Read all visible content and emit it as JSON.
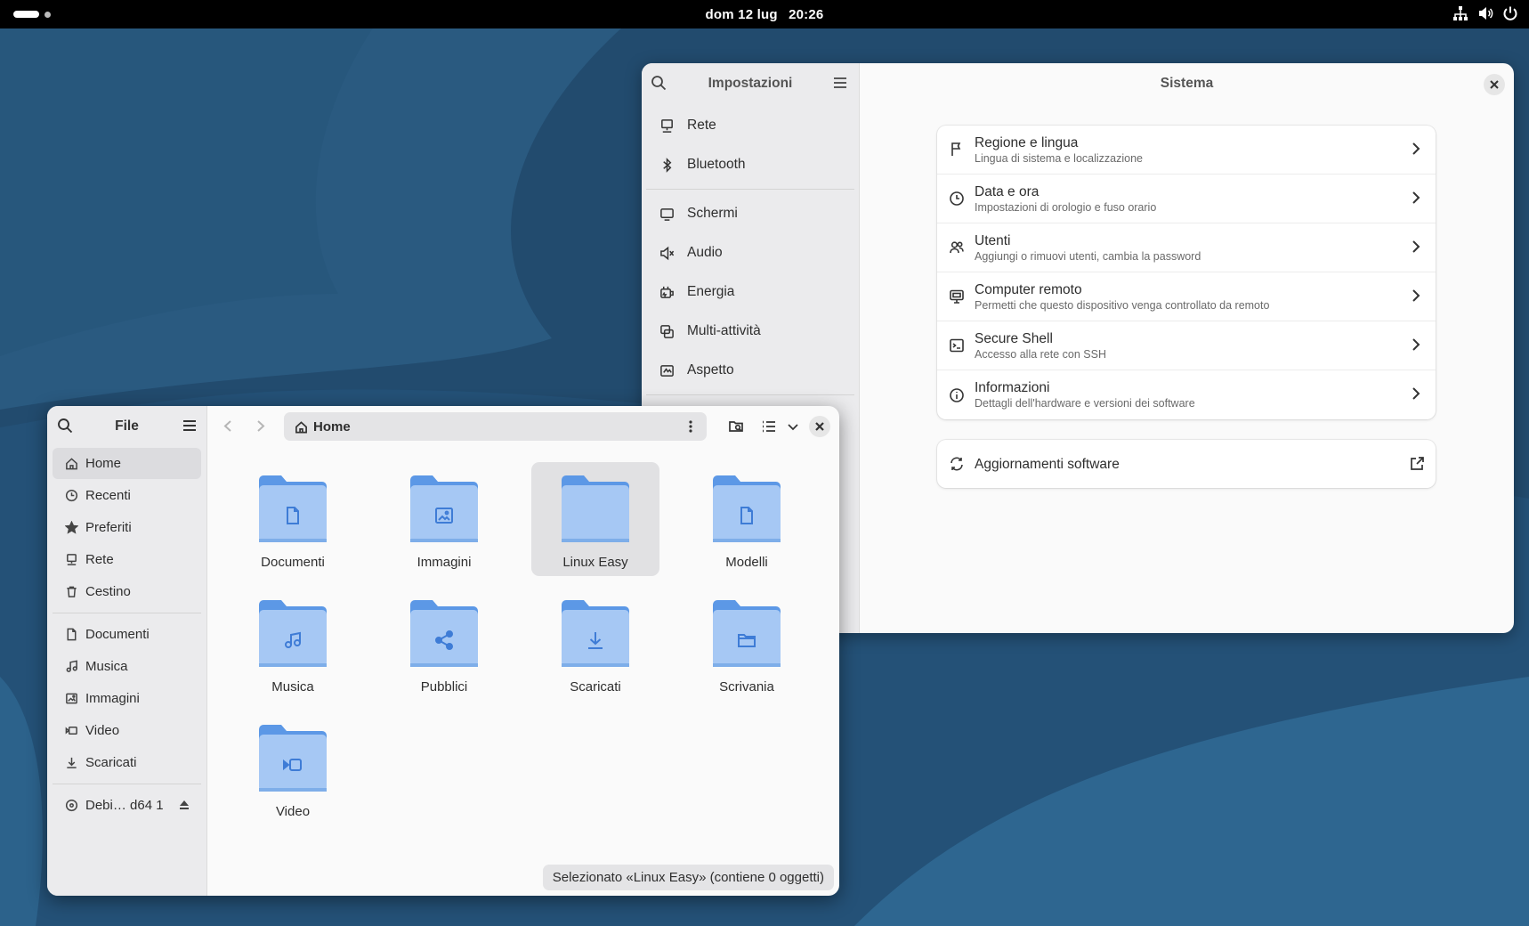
{
  "topbar": {
    "date": "dom 12 lug",
    "time": "20:26",
    "tray_icons": [
      "network-icon",
      "volume-icon",
      "power-icon"
    ]
  },
  "settings": {
    "sidebar_title": "Impostazioni",
    "page_title": "Sistema",
    "sidebar_items": [
      {
        "label": "Rete",
        "icon": "network-icon"
      },
      {
        "label": "Bluetooth",
        "icon": "bluetooth-icon"
      },
      {
        "label": "Schermi",
        "icon": "display-icon"
      },
      {
        "label": "Audio",
        "icon": "speaker-icon"
      },
      {
        "label": "Energia",
        "icon": "power-plug-icon"
      },
      {
        "label": "Multi-attività",
        "icon": "multitasking-icon"
      },
      {
        "label": "Aspetto",
        "icon": "appearance-icon"
      }
    ],
    "rows": [
      {
        "title": "Regione e lingua",
        "subtitle": "Lingua di sistema e localizzazione",
        "icon": "flag-icon"
      },
      {
        "title": "Data e ora",
        "subtitle": "Impostazioni di orologio e fuso orario",
        "icon": "clock-icon"
      },
      {
        "title": "Utenti",
        "subtitle": "Aggiungi o rimuovi utenti, cambia la password",
        "icon": "users-icon"
      },
      {
        "title": "Computer remoto",
        "subtitle": "Permetti che questo dispositivo venga controllato da remoto",
        "icon": "remote-desktop-icon"
      },
      {
        "title": "Secure Shell",
        "subtitle": "Accesso alla rete con SSH",
        "icon": "terminal-icon"
      },
      {
        "title": "Informazioni",
        "subtitle": "Dettagli dell'hardware e versioni dei software",
        "icon": "info-icon"
      }
    ],
    "updates_label": "Aggiornamenti software"
  },
  "files": {
    "sidebar_title": "File",
    "places": [
      {
        "label": "Home",
        "icon": "home-icon",
        "active": true
      },
      {
        "label": "Recenti",
        "icon": "recent-icon"
      },
      {
        "label": "Preferiti",
        "icon": "star-icon"
      },
      {
        "label": "Rete",
        "icon": "network-icon"
      },
      {
        "label": "Cestino",
        "icon": "trash-icon"
      }
    ],
    "bookmarks": [
      {
        "label": "Documenti",
        "icon": "document-icon"
      },
      {
        "label": "Musica",
        "icon": "music-icon"
      },
      {
        "label": "Immagini",
        "icon": "image-icon"
      },
      {
        "label": "Video",
        "icon": "video-icon"
      },
      {
        "label": "Scaricati",
        "icon": "download-icon"
      }
    ],
    "device": {
      "label": "Debi… d64 1",
      "icon": "disc-icon"
    },
    "path": "Home",
    "folders": [
      {
        "label": "Documenti",
        "glyph": "document-icon"
      },
      {
        "label": "Immagini",
        "glyph": "image-icon"
      },
      {
        "label": "Linux Easy",
        "glyph": "",
        "selected": true
      },
      {
        "label": "Modelli",
        "glyph": "template-icon"
      },
      {
        "label": "Musica",
        "glyph": "music-icon"
      },
      {
        "label": "Pubblici",
        "glyph": "share-icon"
      },
      {
        "label": "Scaricati",
        "glyph": "download-icon"
      },
      {
        "label": "Scrivania",
        "glyph": "desktop-folder-icon"
      },
      {
        "label": "Video",
        "glyph": "video-icon"
      }
    ],
    "status": "Selezionato «Linux Easy»  (contiene 0 oggetti)"
  },
  "colors": {
    "folder_back": "#5c98e6",
    "folder_front": "#a6c8f4",
    "glyph": "#3e7cd6",
    "desktop": "#2d5d84"
  }
}
